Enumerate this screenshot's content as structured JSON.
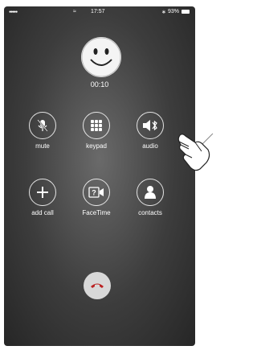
{
  "status_bar": {
    "signal": "●●●●●",
    "wifi": "≈",
    "time": "17:57",
    "battery": "93%",
    "bluetooth": "∗"
  },
  "call": {
    "duration": "00:10",
    "avatar_icon": "smiley-face-icon"
  },
  "buttons": {
    "mute": {
      "label": "mute",
      "icon": "muted-microphone-icon"
    },
    "keypad": {
      "label": "keypad",
      "icon": "keypad-grid-icon"
    },
    "audio": {
      "label": "audio",
      "icon": "bluetooth-speaker-icon"
    },
    "add_call": {
      "label": "add call",
      "icon": "plus-icon"
    },
    "facetime": {
      "label": "FaceTime",
      "icon": "facetime-camera-icon"
    },
    "contacts": {
      "label": "contacts",
      "icon": "person-icon"
    }
  },
  "end_call": {
    "icon": "hang-up-phone-icon"
  },
  "annotation": {
    "icon": "pointing-hand-icon"
  }
}
